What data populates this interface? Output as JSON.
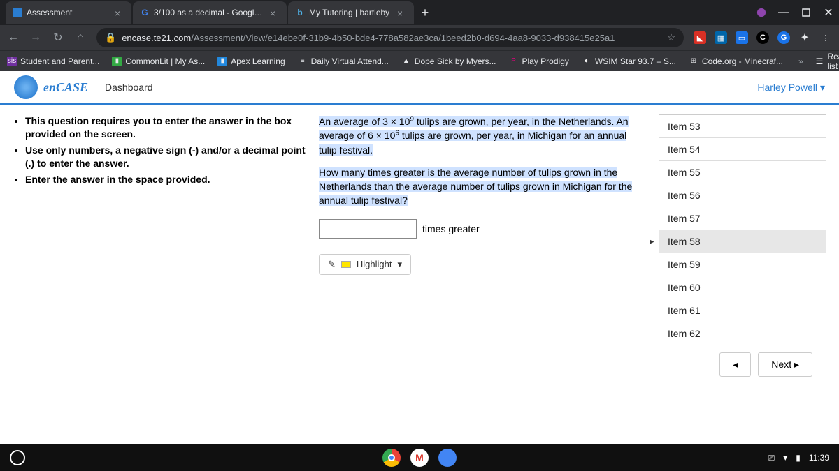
{
  "browser": {
    "tabs": [
      {
        "title": "Assessment",
        "icon_bg": "#2a7dd1"
      },
      {
        "title": "3/100 as a decimal - Google Sea",
        "icon_letter": "G"
      },
      {
        "title": "My Tutoring | bartleby",
        "icon_letter": "b"
      }
    ],
    "url_host": "encase.te21.com",
    "url_path": "/Assessment/View/e14ebe0f-31b9-4b50-bde4-778a582ae3ca/1beed2b0-d694-4aa8-9033-d938415e25a1"
  },
  "bookmarks": [
    "Student and Parent...",
    "CommonLit | My As...",
    "Apex Learning",
    "Daily Virtual Attend...",
    "Dope Sick by Myers...",
    "Play Prodigy",
    "WSIM Star 93.7 – S...",
    "Code.org - Minecraf..."
  ],
  "reading_list_label": "Reading list",
  "app": {
    "logo": "enCASE",
    "dashboard": "Dashboard",
    "user_name": "Harley Powell"
  },
  "instructions": [
    "This question requires you to enter the answer in the box provided on the screen.",
    "Use only numbers, a negative sign (-) and/or a decimal point (.) to enter the answer.",
    "Enter the answer in the space provided."
  ],
  "question": {
    "p1_a": "An average of ",
    "p1_b": "3 × 10",
    "p1_sup1": "9",
    "p1_c": " tulips are grown, per year, in the Netherlands. An average of ",
    "p1_d": "6 × 10",
    "p1_sup2": "6",
    "p1_e": " tulips are grown, per year, in Michigan for an annual tulip festival.",
    "p2": "How many times greater is the average number of tulips grown in the Netherlands than the average number of tulips grown in Michigan for the annual tulip festival?",
    "answer_label": "times greater",
    "answer_value": "",
    "highlight_label": "Highlight"
  },
  "items": [
    {
      "label": "Item 53"
    },
    {
      "label": "Item 54"
    },
    {
      "label": "Item 55"
    },
    {
      "label": "Item 56"
    },
    {
      "label": "Item 57"
    },
    {
      "label": "Item 58",
      "current": true
    },
    {
      "label": "Item 59"
    },
    {
      "label": "Item 60"
    },
    {
      "label": "Item 61"
    },
    {
      "label": "Item 62"
    }
  ],
  "nav": {
    "prev": "◂",
    "next": "Next ▸"
  },
  "taskbar": {
    "time": "11:39"
  },
  "colors": {
    "accent": "#2a7dd1",
    "highlight": "#cfe2ff"
  }
}
